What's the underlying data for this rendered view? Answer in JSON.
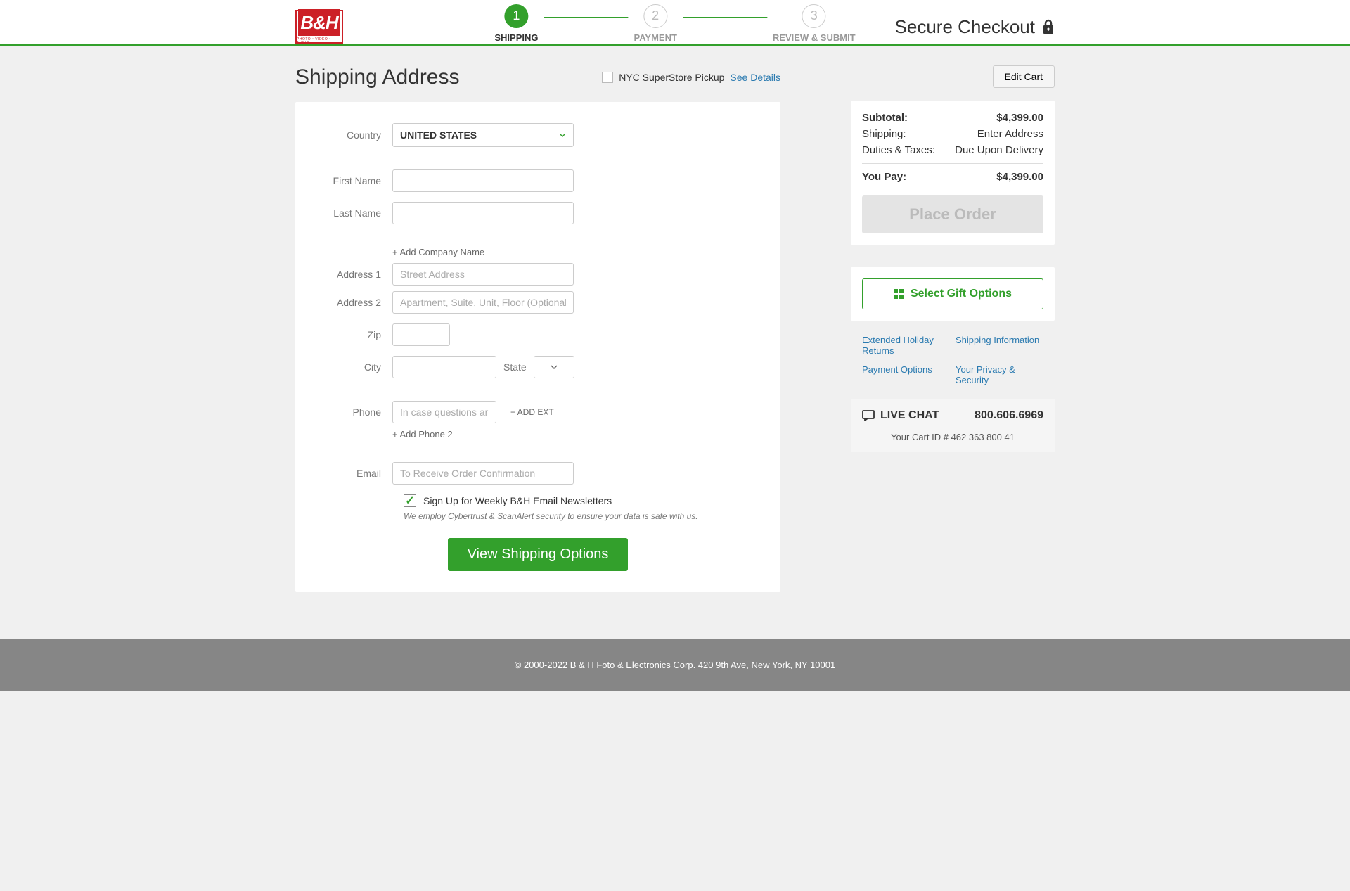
{
  "header": {
    "logo_text": "B&H",
    "logo_sub": "PHOTO • VIDEO • AUDIO",
    "secure_label": "Secure Checkout"
  },
  "steps": [
    {
      "num": "1",
      "label": "SHIPPING",
      "active": true
    },
    {
      "num": "2",
      "label": "PAYMENT",
      "active": false
    },
    {
      "num": "3",
      "label": "REVIEW & SUBMIT",
      "active": false
    }
  ],
  "page_title": "Shipping Address",
  "pickup": {
    "label": "NYC SuperStore Pickup",
    "details": "See Details"
  },
  "form": {
    "country_label": "Country",
    "country_value": "UNITED STATES",
    "first_name_label": "First Name",
    "last_name_label": "Last Name",
    "add_company": "+ Add Company Name",
    "address1_label": "Address 1",
    "address1_placeholder": "Street Address",
    "address2_label": "Address 2",
    "address2_placeholder": "Apartment, Suite, Unit, Floor (Optional)",
    "zip_label": "Zip",
    "city_label": "City",
    "state_label": "State",
    "phone_label": "Phone",
    "phone_placeholder": "In case questions arise",
    "add_ext": "+ ADD EXT",
    "add_phone": "+ Add Phone 2",
    "email_label": "Email",
    "email_placeholder": "To Receive Order Confirmation",
    "newsletter": "Sign Up for Weekly B&H Email Newsletters",
    "security_note": "We employ Cybertrust & ScanAlert security to ensure your data is safe with us.",
    "submit": "View Shipping Options"
  },
  "sidebar": {
    "edit_cart": "Edit Cart",
    "subtotal_label": "Subtotal:",
    "subtotal_value": "$4,399.00",
    "shipping_label": "Shipping:",
    "shipping_value": "Enter Address",
    "duties_label": "Duties & Taxes:",
    "duties_value": "Due Upon Delivery",
    "youpay_label": "You Pay:",
    "youpay_value": "$4,399.00",
    "place_order": "Place Order",
    "gift_options": "Select Gift Options",
    "links": {
      "returns": "Extended Holiday Returns",
      "shipping_info": "Shipping Information",
      "payment_options": "Payment Options",
      "privacy": "Your Privacy & Security"
    },
    "live_chat": "LIVE CHAT",
    "phone": "800.606.6969",
    "cart_id": "Your Cart ID # 462 363 800 41"
  },
  "footer": "© 2000-2022 B & H Foto & Electronics Corp. 420 9th Ave, New York, NY 10001"
}
